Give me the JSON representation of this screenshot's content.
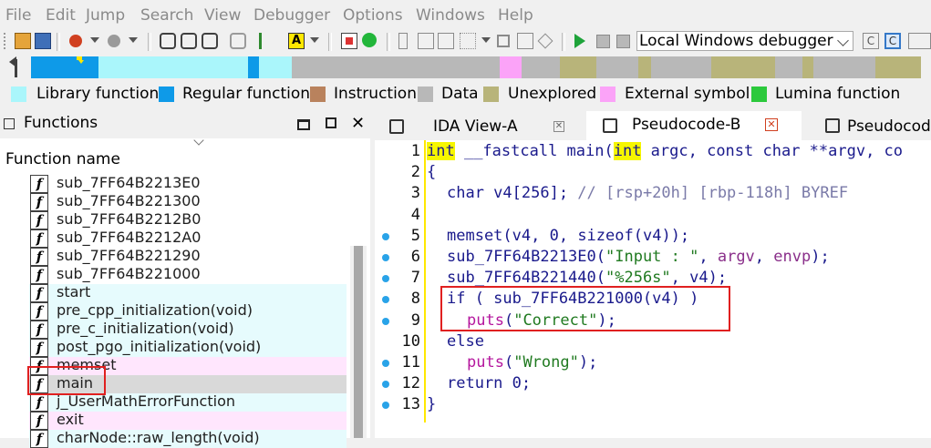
{
  "menu": [
    "File",
    "Edit",
    "Jump",
    "Search",
    "View",
    "Debugger",
    "Options",
    "Windows",
    "Help"
  ],
  "toolbar": {
    "debugger_select": "Local Windows debugger"
  },
  "legend": [
    {
      "label": "Library function",
      "color": "#aaf6fb"
    },
    {
      "label": "Regular function",
      "color": "#0e9ae8"
    },
    {
      "label": "Instruction",
      "color": "#b9825d"
    },
    {
      "label": "Data",
      "color": "#b8b8b8"
    },
    {
      "label": "Unexplored",
      "color": "#b8b47a"
    },
    {
      "label": "External symbol",
      "color": "#fba3f8"
    },
    {
      "label": "Lumina function",
      "color": "#2cc93c"
    }
  ],
  "functions": {
    "title": "Functions",
    "column_header": "Function name",
    "items": [
      {
        "name": "sub_7FF64B2213E0",
        "bg": "#ffffff"
      },
      {
        "name": "sub_7FF64B221300",
        "bg": "#ffffff"
      },
      {
        "name": "sub_7FF64B2212B0",
        "bg": "#ffffff"
      },
      {
        "name": "sub_7FF64B2212A0",
        "bg": "#ffffff"
      },
      {
        "name": "sub_7FF64B221290",
        "bg": "#ffffff"
      },
      {
        "name": "sub_7FF64B221000",
        "bg": "#ffffff"
      },
      {
        "name": "start",
        "bg": "#e6fbfd"
      },
      {
        "name": "pre_cpp_initialization(void)",
        "bg": "#e6fbfd"
      },
      {
        "name": "pre_c_initialization(void)",
        "bg": "#e6fbfd"
      },
      {
        "name": "post_pgo_initialization(void)",
        "bg": "#e6fbfd"
      },
      {
        "name": "memset",
        "bg": "#ffe6fd"
      },
      {
        "name": "main",
        "bg": "#d9d9d9"
      },
      {
        "name": "j_UserMathErrorFunction",
        "bg": "#e6fbfd"
      },
      {
        "name": "exit",
        "bg": "#ffe6fd"
      },
      {
        "name": "charNode::raw_length(void)",
        "bg": "#e6fbfd"
      }
    ]
  },
  "tabs": [
    {
      "label": "IDA View-A"
    },
    {
      "label": "Pseudocode-B"
    },
    {
      "label": "Pseudocod"
    }
  ],
  "code_lines": [
    {
      "num": "1",
      "dot": false,
      "indent": 0,
      "segs": [
        [
          "int",
          "#1a1a8c",
          true
        ],
        [
          " __fastcall main(",
          "#1a1a8c",
          false
        ],
        [
          "int",
          "#1a1a8c",
          true
        ],
        [
          " argc, const char **argv, co",
          "#1a1a8c",
          false
        ]
      ]
    },
    {
      "num": "2",
      "dot": false,
      "indent": 0,
      "segs": [
        [
          "{",
          "#1a1a8c",
          false
        ]
      ]
    },
    {
      "num": "3",
      "dot": false,
      "indent": 2,
      "segs": [
        [
          "char v4[256]; ",
          "#1a1a8c",
          false
        ],
        [
          "// [rsp+20h] [rbp-118h] BYREF",
          "#7a7aa8",
          false
        ]
      ]
    },
    {
      "num": "4",
      "dot": false,
      "indent": 0,
      "segs": []
    },
    {
      "num": "5",
      "dot": true,
      "indent": 2,
      "segs": [
        [
          "memset(",
          "#1a1a8c",
          false
        ],
        [
          "v4",
          "#1a1a8c",
          false
        ],
        [
          ", 0, sizeof(",
          "#1a1a8c",
          false
        ],
        [
          "v4",
          "#1a1a8c",
          false
        ],
        [
          "));",
          "#1a1a8c",
          false
        ]
      ]
    },
    {
      "num": "6",
      "dot": true,
      "indent": 2,
      "segs": [
        [
          "sub_7FF64B2213E0(",
          "#1a1a8c",
          false
        ],
        [
          "\"Input : \"",
          "#207a20",
          false
        ],
        [
          ", ",
          "#1a1a8c",
          false
        ],
        [
          "argv",
          "#8a2f8a",
          false
        ],
        [
          ", ",
          "#1a1a8c",
          false
        ],
        [
          "envp",
          "#8a2f8a",
          false
        ],
        [
          ");",
          "#1a1a8c",
          false
        ]
      ]
    },
    {
      "num": "7",
      "dot": true,
      "indent": 2,
      "segs": [
        [
          "sub_7FF64B221440(",
          "#1a1a8c",
          false
        ],
        [
          "\"%256s\"",
          "#207a20",
          false
        ],
        [
          ", ",
          "#1a1a8c",
          false
        ],
        [
          "v4",
          "#1a1a8c",
          false
        ],
        [
          ");",
          "#1a1a8c",
          false
        ]
      ]
    },
    {
      "num": "8",
      "dot": true,
      "indent": 2,
      "segs": [
        [
          "if ( sub_7FF64B221000(",
          "#1a1a8c",
          false
        ],
        [
          "v4",
          "#1a1a8c",
          false
        ],
        [
          ") )",
          "#1a1a8c",
          false
        ]
      ]
    },
    {
      "num": "9",
      "dot": true,
      "indent": 4,
      "segs": [
        [
          "puts",
          "#b5179e",
          false
        ],
        [
          "(",
          "#1a1a8c",
          false
        ],
        [
          "\"Correct\"",
          "#207a20",
          false
        ],
        [
          ");",
          "#1a1a8c",
          false
        ]
      ]
    },
    {
      "num": "10",
      "dot": false,
      "indent": 2,
      "segs": [
        [
          "else",
          "#1a1a8c",
          false
        ]
      ]
    },
    {
      "num": "11",
      "dot": true,
      "indent": 4,
      "segs": [
        [
          "puts",
          "#b5179e",
          false
        ],
        [
          "(",
          "#1a1a8c",
          false
        ],
        [
          "\"Wrong\"",
          "#207a20",
          false
        ],
        [
          ");",
          "#1a1a8c",
          false
        ]
      ]
    },
    {
      "num": "12",
      "dot": true,
      "indent": 2,
      "segs": [
        [
          "return 0;",
          "#1a1a8c",
          false
        ]
      ]
    },
    {
      "num": "13",
      "dot": true,
      "indent": 0,
      "segs": [
        [
          "}",
          "#1a1a8c",
          false
        ]
      ]
    }
  ]
}
